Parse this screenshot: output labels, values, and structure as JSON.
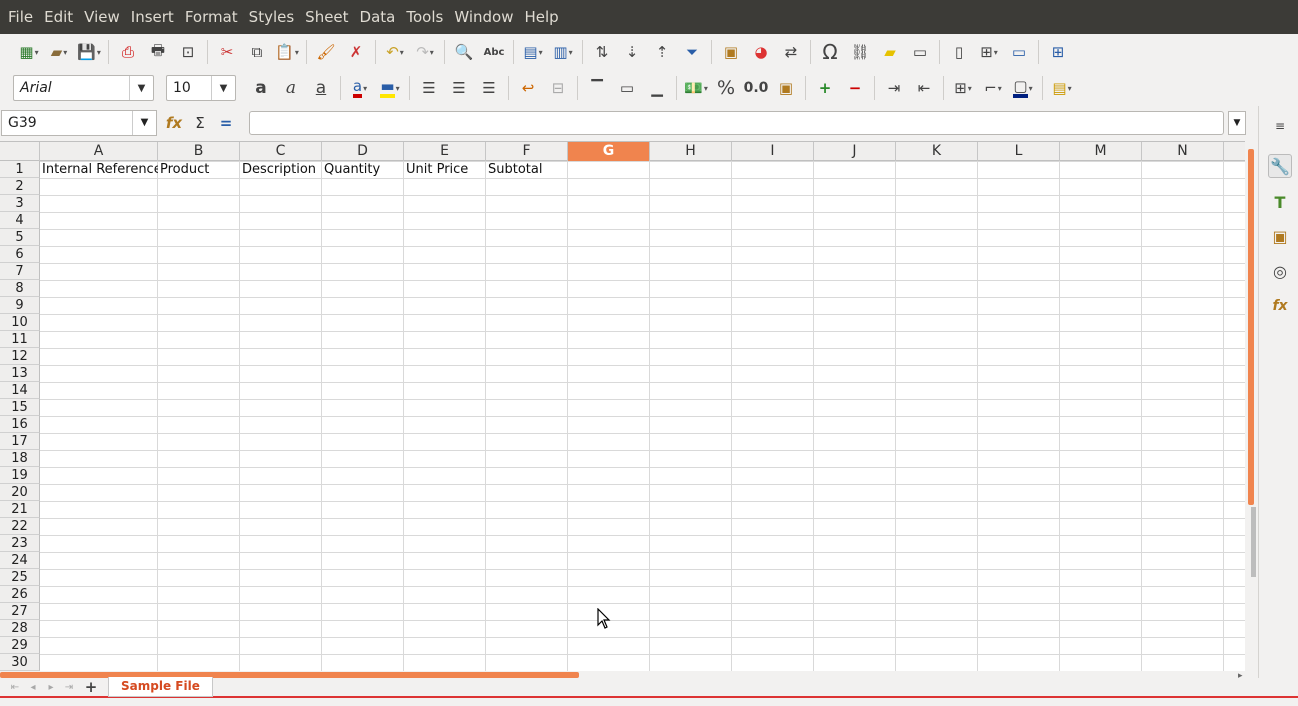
{
  "menu": [
    "File",
    "Edit",
    "View",
    "Insert",
    "Format",
    "Styles",
    "Sheet",
    "Data",
    "Tools",
    "Window",
    "Help"
  ],
  "font": {
    "name": "Arial",
    "size": "10"
  },
  "namebox": {
    "value": "G39"
  },
  "columns": [
    "A",
    "B",
    "C",
    "D",
    "E",
    "F",
    "G",
    "H",
    "I",
    "J",
    "K",
    "L",
    "M",
    "N"
  ],
  "selected_column": "G",
  "rows": [
    "1",
    "2",
    "3",
    "4",
    "5",
    "6",
    "7",
    "8",
    "9",
    "10",
    "11",
    "12",
    "13",
    "14",
    "15",
    "16",
    "17",
    "18",
    "19",
    "20",
    "21",
    "22",
    "23",
    "24",
    "25",
    "26",
    "27",
    "28",
    "29",
    "30"
  ],
  "header_row": [
    "Internal Reference",
    "Product",
    "Description",
    "Quantity",
    "Unit Price",
    "Subtotal"
  ],
  "sheet_tab": "Sample File",
  "colors": {
    "accent": "#f0844e",
    "menubar": "#3c3b37",
    "tab_text": "#d54a20"
  }
}
